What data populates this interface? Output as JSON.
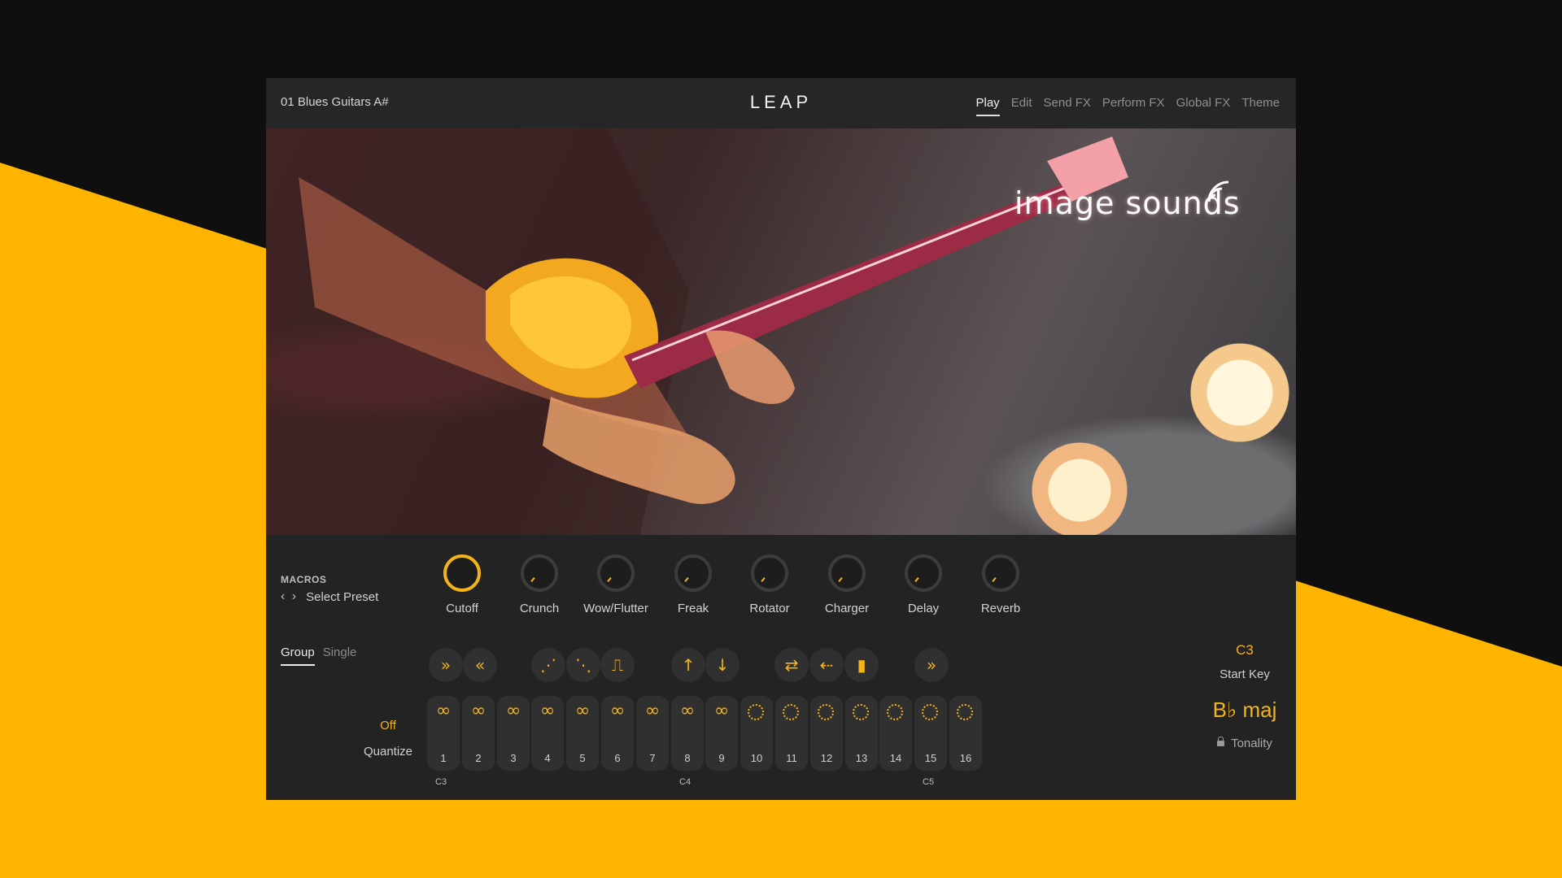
{
  "header": {
    "preset": "01 Blues Guitars A#",
    "logo": "LEAP",
    "tabs": [
      "Play",
      "Edit",
      "Send FX",
      "Perform FX",
      "Global FX",
      "Theme"
    ],
    "active_tab": "Play"
  },
  "hero": {
    "brand": "image sounds"
  },
  "macros": {
    "title": "MACROS",
    "select_preset": "Select Preset",
    "knobs": [
      "Cutoff",
      "Crunch",
      "Wow/Flutter",
      "Freak",
      "Rotator",
      "Charger",
      "Delay",
      "Reverb"
    ],
    "active_knob": "Cutoff"
  },
  "mode": {
    "tabs": [
      "Group",
      "Single"
    ],
    "active": "Group"
  },
  "quantize": {
    "value": "Off",
    "label": "Quantize"
  },
  "fx_buttons": [
    {
      "icon": "fast-forward-icon",
      "glyph": "»"
    },
    {
      "icon": "rewind-icon",
      "glyph": "«"
    },
    {
      "icon": "stutter-icon",
      "glyph": "⋰"
    },
    {
      "icon": "stutter-alt-icon",
      "glyph": "⋱"
    },
    {
      "icon": "waveform-icon",
      "glyph": "⎍"
    },
    {
      "icon": "arrow-up-icon",
      "glyph": "↑"
    },
    {
      "icon": "arrow-down-icon",
      "glyph": "↓"
    },
    {
      "icon": "swap-icon",
      "glyph": "⇄"
    },
    {
      "icon": "scatter-icon",
      "glyph": "⇠"
    },
    {
      "icon": "bars-icon",
      "glyph": "▮"
    },
    {
      "icon": "skip-icon",
      "glyph": "»"
    }
  ],
  "pads": {
    "numbers": [
      "1",
      "2",
      "3",
      "4",
      "5",
      "6",
      "7",
      "8",
      "9",
      "10",
      "11",
      "12",
      "13",
      "14",
      "15",
      "16"
    ],
    "looped_count": 9,
    "notes": [
      "C3",
      "C4",
      "C5"
    ]
  },
  "start_key": {
    "value": "C3",
    "label": "Start Key"
  },
  "tonality": {
    "value": "B♭ maj",
    "label": "Tonality"
  },
  "colors": {
    "accent": "#f2b31b",
    "background_yellow": "#ffb400",
    "panel": "#232323"
  }
}
